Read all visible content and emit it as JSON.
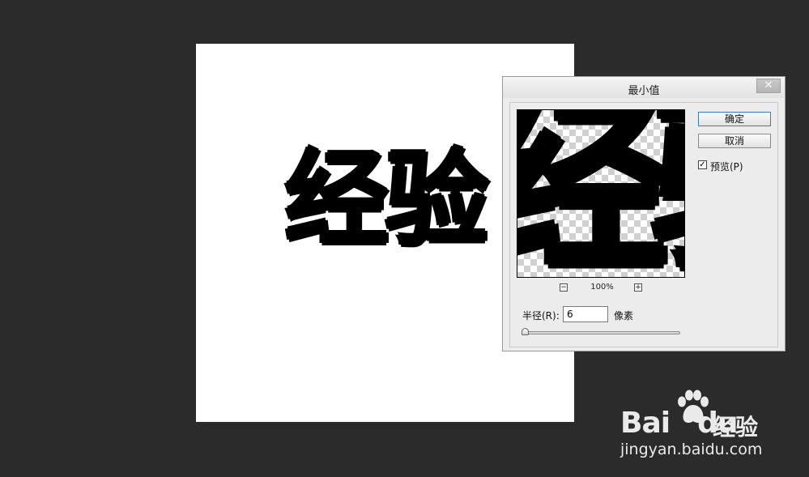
{
  "canvas": {
    "text": "经验"
  },
  "dialog": {
    "title": "最小值",
    "close_symbol": "✕",
    "preview_text": "经验",
    "zoom_out": "−",
    "zoom_in": "+",
    "zoom_level": "100%",
    "ok_label": "确定",
    "cancel_label": "取消",
    "preview_checkbox": {
      "label": "预览(P)",
      "checked": true,
      "mark": "✓"
    },
    "radius": {
      "label": "半径(R):",
      "value": "6",
      "unit": "像素"
    }
  },
  "watermark": {
    "brand": "Bai",
    "brand_suffix": "du",
    "brand_cn": "经验",
    "url": "jingyan.baidu.com",
    "icon": "paw-icon"
  },
  "colors": {
    "workspace": "#2b2b2b",
    "dialog_bg": "#ececec",
    "ok_border": "#3c7fb1"
  }
}
